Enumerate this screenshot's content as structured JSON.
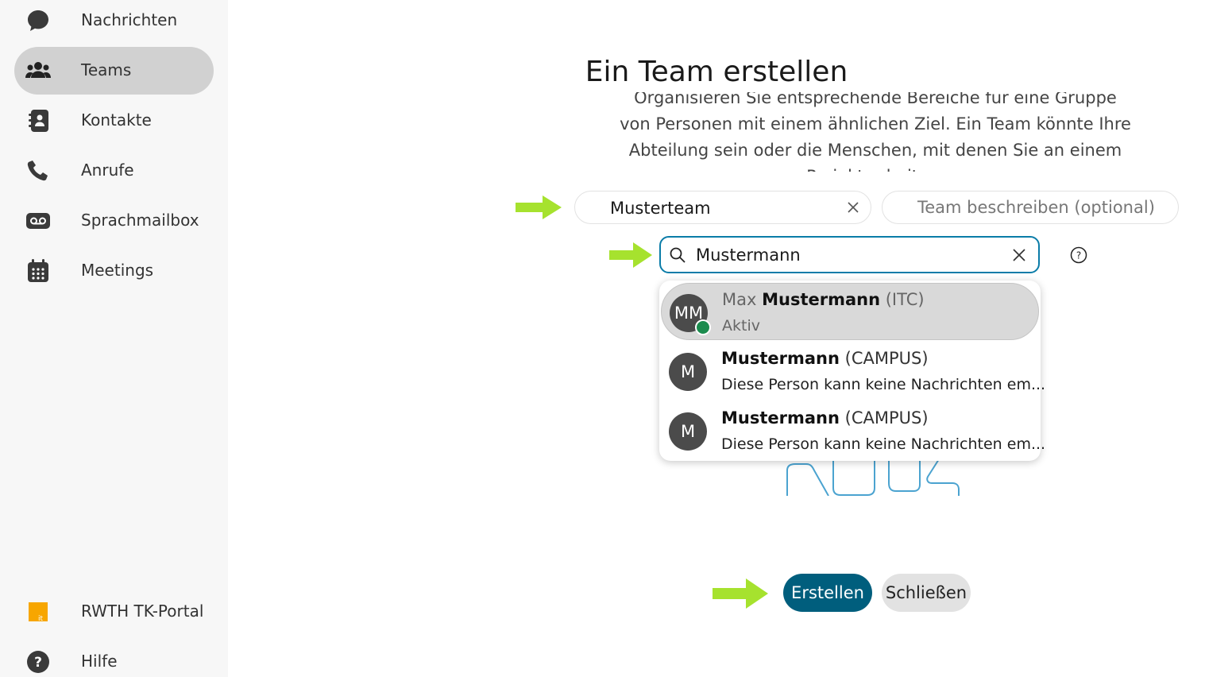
{
  "sidebar": {
    "items": [
      {
        "label": "Nachrichten",
        "icon": "chat-bubble-icon",
        "active": false
      },
      {
        "label": "Teams",
        "icon": "people-icon",
        "active": true
      },
      {
        "label": "Kontakte",
        "icon": "contact-book-icon",
        "active": false
      },
      {
        "label": "Anrufe",
        "icon": "phone-icon",
        "active": false
      },
      {
        "label": "Sprachmailbox",
        "icon": "voicemail-icon",
        "active": false
      },
      {
        "label": "Meetings",
        "icon": "calendar-icon",
        "active": false
      }
    ],
    "bottom": [
      {
        "label": "RWTH TK-Portal",
        "icon": "rwth-it-logo"
      },
      {
        "label": "Hilfe",
        "icon": "help-circle-icon"
      }
    ]
  },
  "dialog": {
    "title": "Ein Team erstellen",
    "description": "Organisieren Sie entsprechende Bereiche für eine Gruppe von Personen mit einem ähnlichen Ziel. Ein Team könnte Ihre Abteilung sein oder die Menschen, mit denen Sie an einem Projekt arbeiten.",
    "team_name_value": "Musterteam",
    "team_description_placeholder": "Team beschreiben (optional)",
    "search_value": "Mustermann",
    "results": [
      {
        "initials": "MM",
        "name_prefix": "Max ",
        "name_match": "Mustermann",
        "name_suffix": " (ITC)",
        "subtitle": "Aktiv",
        "presence": "online"
      },
      {
        "initials": "M",
        "name_prefix": "",
        "name_match": "Mustermann",
        "name_suffix": " (CAMPUS)",
        "subtitle": "Diese Person kann keine Nachrichten em..."
      },
      {
        "initials": "M",
        "name_prefix": "",
        "name_match": "Mustermann",
        "name_suffix": " (CAMPUS)",
        "subtitle": "Diese Person kann keine Nachrichten em..."
      }
    ],
    "create_label": "Erstellen",
    "close_label": "Schließen"
  },
  "colors": {
    "accent": "#005e7d",
    "focus_border": "#0a7ca8",
    "annotation_arrow": "#a6e22e",
    "presence_online": "#1b8c4e",
    "active_nav": "#d1d1d1"
  }
}
